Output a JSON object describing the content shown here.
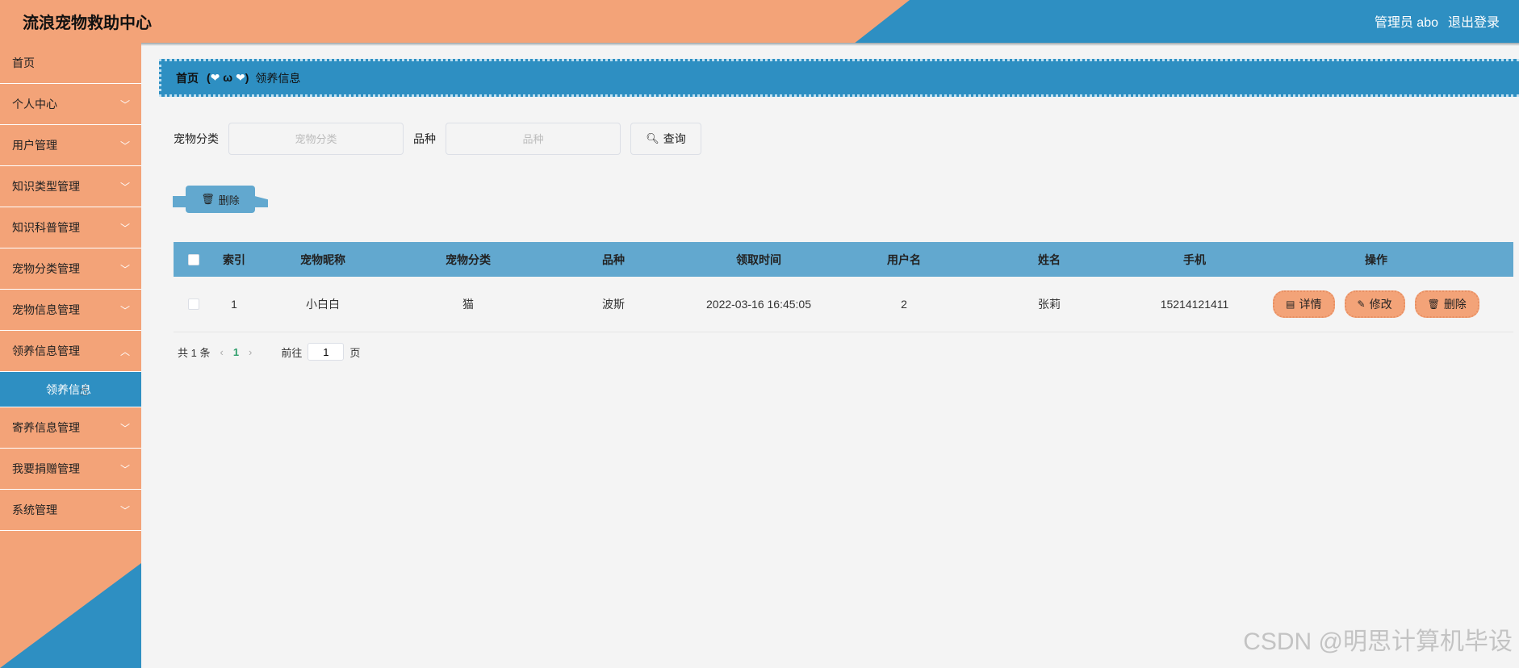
{
  "header": {
    "title": "流浪宠物救助中心",
    "admin": "管理员 abo",
    "logout": "退出登录"
  },
  "colors": {
    "orange": "#f3a378",
    "blue": "#2e8fc2",
    "table_header": "#62a8cf"
  },
  "sidebar": {
    "items": [
      {
        "label": "首页"
      },
      {
        "label": "个人中心"
      },
      {
        "label": "用户管理"
      },
      {
        "label": "知识类型管理"
      },
      {
        "label": "知识科普管理"
      },
      {
        "label": "宠物分类管理"
      },
      {
        "label": "宠物信息管理"
      },
      {
        "label": "领养信息管理"
      },
      {
        "label": "领养信息"
      },
      {
        "label": "寄养信息管理"
      },
      {
        "label": "我要捐赠管理"
      },
      {
        "label": "系统管理"
      }
    ]
  },
  "breadcrumb": {
    "home": "首页",
    "separator_left": "(",
    "separator_heart": "❤",
    "separator_mid": " ω ",
    "separator_right": ")",
    "current": "领养信息"
  },
  "search": {
    "category_label": "宠物分类",
    "category_placeholder": "宠物分类",
    "breed_label": "品种",
    "breed_placeholder": "品种",
    "query_button": "查询"
  },
  "toolbar": {
    "delete_label": "删除"
  },
  "table": {
    "columns": [
      "索引",
      "宠物昵称",
      "宠物分类",
      "品种",
      "领取时间",
      "用户名",
      "姓名",
      "手机",
      "操作"
    ],
    "rows": [
      {
        "index": "1",
        "pet_name": "小白白",
        "category": "猫",
        "breed": "波斯",
        "time": "2022-03-16 16:45:05",
        "username": "2",
        "name": "张莉",
        "phone": "15214121411",
        "actions": {
          "detail": "详情",
          "edit": "修改",
          "delete": "删除"
        }
      }
    ]
  },
  "pagination": {
    "total": "共 1 条",
    "current_page": "1",
    "goto_label": "前往",
    "goto_value": "1",
    "page_suffix": "页"
  },
  "watermark": "CSDN @明思计算机毕设"
}
